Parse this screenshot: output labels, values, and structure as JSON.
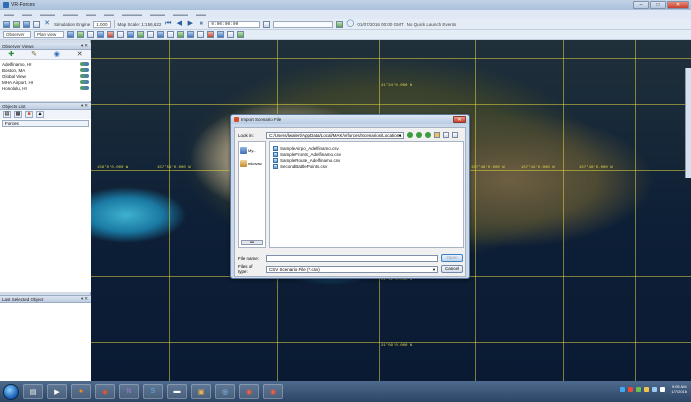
{
  "window": {
    "title": "VR-Forces"
  },
  "toolbar": {
    "sim_engine_label": "Simulation Engine",
    "sim_engine_value": "1.000",
    "map_scale_label": "Map Scale: 1:156,622",
    "sim_time": "0:00:00:00",
    "sim_datetime": "01/07/2016 00:00 GMT",
    "quick_launch_label": "No Quick Launch Events",
    "observer_label": "Observer",
    "plan_view_label": "Plan view"
  },
  "observer_panel": {
    "title": "Observer Views",
    "items": [
      {
        "label": "Adelfinamo, HI"
      },
      {
        "label": "Boston, MA"
      },
      {
        "label": "Global View"
      },
      {
        "label": "MHA Airport, HI"
      },
      {
        "label": "Honolulu, HI"
      }
    ]
  },
  "objects_panel": {
    "title": "Objects List",
    "root_label": "Forces"
  },
  "selected_panel": {
    "title": "Last Selected Object"
  },
  "map": {
    "coords": [
      {
        "label": "21°24'0.000 N"
      },
      {
        "label": "158°0'0.000 W"
      },
      {
        "label": "157°59'0.000 W"
      },
      {
        "label": "157°48'0.000 W"
      },
      {
        "label": "157°44'0.000 W"
      },
      {
        "label": "157°40'0.000 W"
      },
      {
        "label": "21°12'0.000 N"
      },
      {
        "label": "21°09'0.000 N"
      }
    ],
    "colors": {
      "grid": "#dcd23c",
      "ocean": "#0d1f36"
    }
  },
  "dialog": {
    "title": "Import Scenario File",
    "look_in_label": "Look in:",
    "look_in_value": "C:/Users/lwalert/AppData/Local/MAK/vrforces/Scenarios/Locations",
    "places": [
      {
        "label": "My..."
      },
      {
        "label": "mkovac"
      }
    ],
    "files": [
      {
        "name": "SampleAirpo_Adelfinamo.csv"
      },
      {
        "name": "SampleFronts_Adelfinamo.csv"
      },
      {
        "name": "SampleRoute_Adelfinamo.csv"
      },
      {
        "name": "SecondBattlePoints.csv"
      }
    ],
    "file_name_label": "File name:",
    "file_name_value": "",
    "file_type_label": "Files of type:",
    "file_type_value": "CSV Scenario File (*.csv)",
    "open_label": "Open",
    "cancel_label": "Cancel"
  },
  "taskbar": {
    "clock_time": "9:05 AM",
    "clock_date": "1/7/2016"
  }
}
